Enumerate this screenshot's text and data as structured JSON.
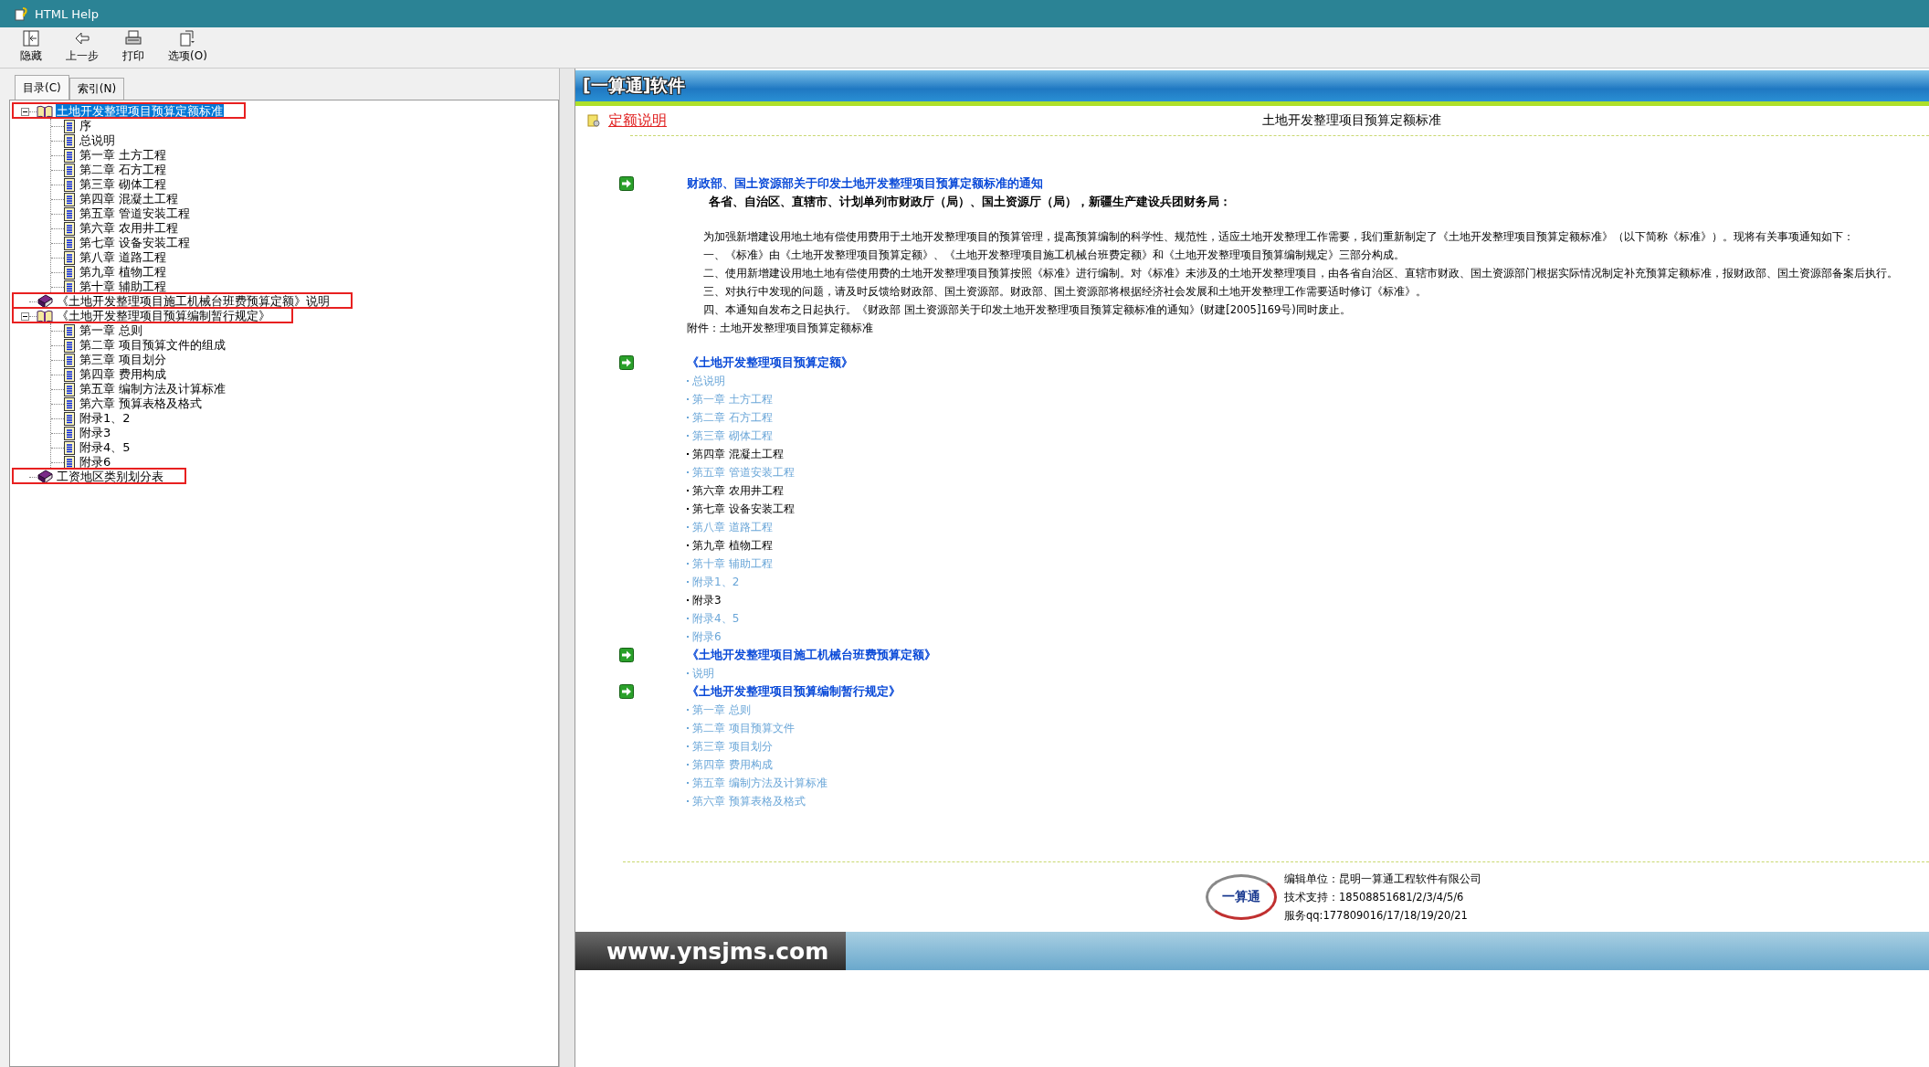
{
  "window": {
    "title": "HTML Help"
  },
  "toolbar": [
    {
      "label": "隐藏",
      "kind": "hide"
    },
    {
      "label": "上一步",
      "kind": "back"
    },
    {
      "label": "打印",
      "kind": "print"
    },
    {
      "label": "选项(O)",
      "kind": "options"
    }
  ],
  "nav_tabs": [
    {
      "label": "目录(C)",
      "selected": true
    },
    {
      "label": "索引(N)",
      "selected": false
    }
  ],
  "tree": [
    {
      "label": "土地开发整理项目预算定额标准",
      "kind": "book",
      "expanded": true,
      "selected": true,
      "highlighted": true,
      "children": [
        {
          "label": "序",
          "kind": "page"
        },
        {
          "label": "总说明",
          "kind": "page"
        },
        {
          "label": "第一章  土方工程",
          "kind": "page"
        },
        {
          "label": "第二章  石方工程",
          "kind": "page"
        },
        {
          "label": "第三章  砌体工程",
          "kind": "page"
        },
        {
          "label": "第四章  混凝土工程",
          "kind": "page"
        },
        {
          "label": "第五章  管道安装工程",
          "kind": "page"
        },
        {
          "label": "第六章  农用井工程",
          "kind": "page"
        },
        {
          "label": "第七章  设备安装工程",
          "kind": "page"
        },
        {
          "label": "第八章  道路工程",
          "kind": "page"
        },
        {
          "label": "第九章  植物工程",
          "kind": "page"
        },
        {
          "label": "第十章  辅助工程",
          "kind": "page"
        }
      ]
    },
    {
      "label": "《土地开发整理项目施工机械台班费预算定额》说明",
      "kind": "book",
      "expanded": false,
      "selected": false,
      "highlighted": true
    },
    {
      "label": "《土地开发整理项目预算编制暂行规定》",
      "kind": "book",
      "expanded": true,
      "selected": false,
      "highlighted": true,
      "children": [
        {
          "label": "第一章  总则",
          "kind": "page"
        },
        {
          "label": "第二章  项目预算文件的组成",
          "kind": "page"
        },
        {
          "label": "第三章  项目划分",
          "kind": "page"
        },
        {
          "label": "第四章  费用构成",
          "kind": "page"
        },
        {
          "label": "第五章  编制方法及计算标准",
          "kind": "page"
        },
        {
          "label": "第六章  预算表格及格式",
          "kind": "page"
        },
        {
          "label": "附录1、2",
          "kind": "page"
        },
        {
          "label": "附录3",
          "kind": "page"
        },
        {
          "label": "附录4、5",
          "kind": "page"
        },
        {
          "label": "附录6",
          "kind": "page"
        }
      ]
    },
    {
      "label": "工资地区类别划分表",
      "kind": "book",
      "expanded": false,
      "selected": false,
      "highlighted": true
    }
  ],
  "content": {
    "banner_title": "[一算通]软件",
    "section_link": "定额说明",
    "page_title": "土地开发整理项目预算定额标准",
    "notice": {
      "heading": "财政部、国土资源部关于印发土地开发整理项目预算定额标准的通知",
      "addressee": "各省、自治区、直辖市、计划单列市财政厅（局）、国土资源厅（局），新疆生产建设兵团财务局：",
      "paragraphs": [
        "为加强新增建设用地土地有偿使用费用于土地开发整理项目的预算管理，提高预算编制的科学性、规范性，适应土地开发整理工作需要，我们重新制定了《土地开发整理项目预算定额标准》（以下简称《标准》）。现将有关事项通知如下：",
        "一、《标准》由《土地开发整理项目预算定额》、《土地开发整理项目施工机械台班费定额》和《土地开发整理项目预算编制规定》三部分构成。",
        "二、使用新增建设用地土地有偿使用费的土地开发整理项目预算按照《标准》进行编制。对《标准》未涉及的土地开发整理项目，由各省自治区、直辖市财政、国土资源部门根据实际情况制定补充预算定额标准，报财政部、国土资源部备案后执行。",
        "三、对执行中发现的问题，请及时反馈给财政部、国土资源部。财政部、国土资源部将根据经济社会发展和土地开发整理工作需要适时修订《标准》。",
        " 四、本通知自发布之日起执行。《财政部 国土资源部关于印发土地开发整理项目预算定额标准的通知》(财建[2005]169号)同时废止。"
      ],
      "attachment": "附件：土地开发整理项目预算定额标准"
    },
    "sections": [
      {
        "heading": "《土地开发整理项目预算定额》",
        "items": [
          {
            "label": "总说明",
            "visited": false
          },
          {
            "label": "第一章  土方工程",
            "visited": false
          },
          {
            "label": "第二章  石方工程",
            "visited": false
          },
          {
            "label": "第三章  砌体工程",
            "visited": false
          },
          {
            "label": "第四章  混凝土工程",
            "visited": true
          },
          {
            "label": "第五章  管道安装工程",
            "visited": false
          },
          {
            "label": "第六章  农用井工程",
            "visited": true
          },
          {
            "label": "第七章  设备安装工程",
            "visited": true
          },
          {
            "label": "第八章  道路工程",
            "visited": false
          },
          {
            "label": "第九章  植物工程",
            "visited": true
          },
          {
            "label": "第十章  辅助工程",
            "visited": false
          },
          {
            "label": "附录1、2",
            "visited": false
          },
          {
            "label": "附录3",
            "visited": true
          },
          {
            "label": "附录4、5",
            "visited": false
          },
          {
            "label": "附录6",
            "visited": false
          }
        ]
      },
      {
        "heading": "《土地开发整理项目施工机械台班费预算定额》",
        "items": [
          {
            "label": "说明",
            "visited": false
          }
        ]
      },
      {
        "heading": "《土地开发整理项目预算编制暂行规定》",
        "items": [
          {
            "label": "第一章  总则",
            "visited": false
          },
          {
            "label": "第二章  项目预算文件",
            "visited": false
          },
          {
            "label": "第三章  项目划分",
            "visited": false
          },
          {
            "label": "第四章  费用构成",
            "visited": false
          },
          {
            "label": "第五章  编制方法及计算标准",
            "visited": false
          },
          {
            "label": "第六章  预算表格及格式",
            "visited": false
          }
        ]
      }
    ],
    "footer": {
      "logo_text": "一算通",
      "lines": [
        "编辑单位：昆明一算通工程软件有限公司",
        "技术支持：18508851681/2/3/4/5/6",
        "服务qq:177809016/17/18/19/20/21"
      ],
      "banner_text": "www.ynsjms.com"
    }
  }
}
